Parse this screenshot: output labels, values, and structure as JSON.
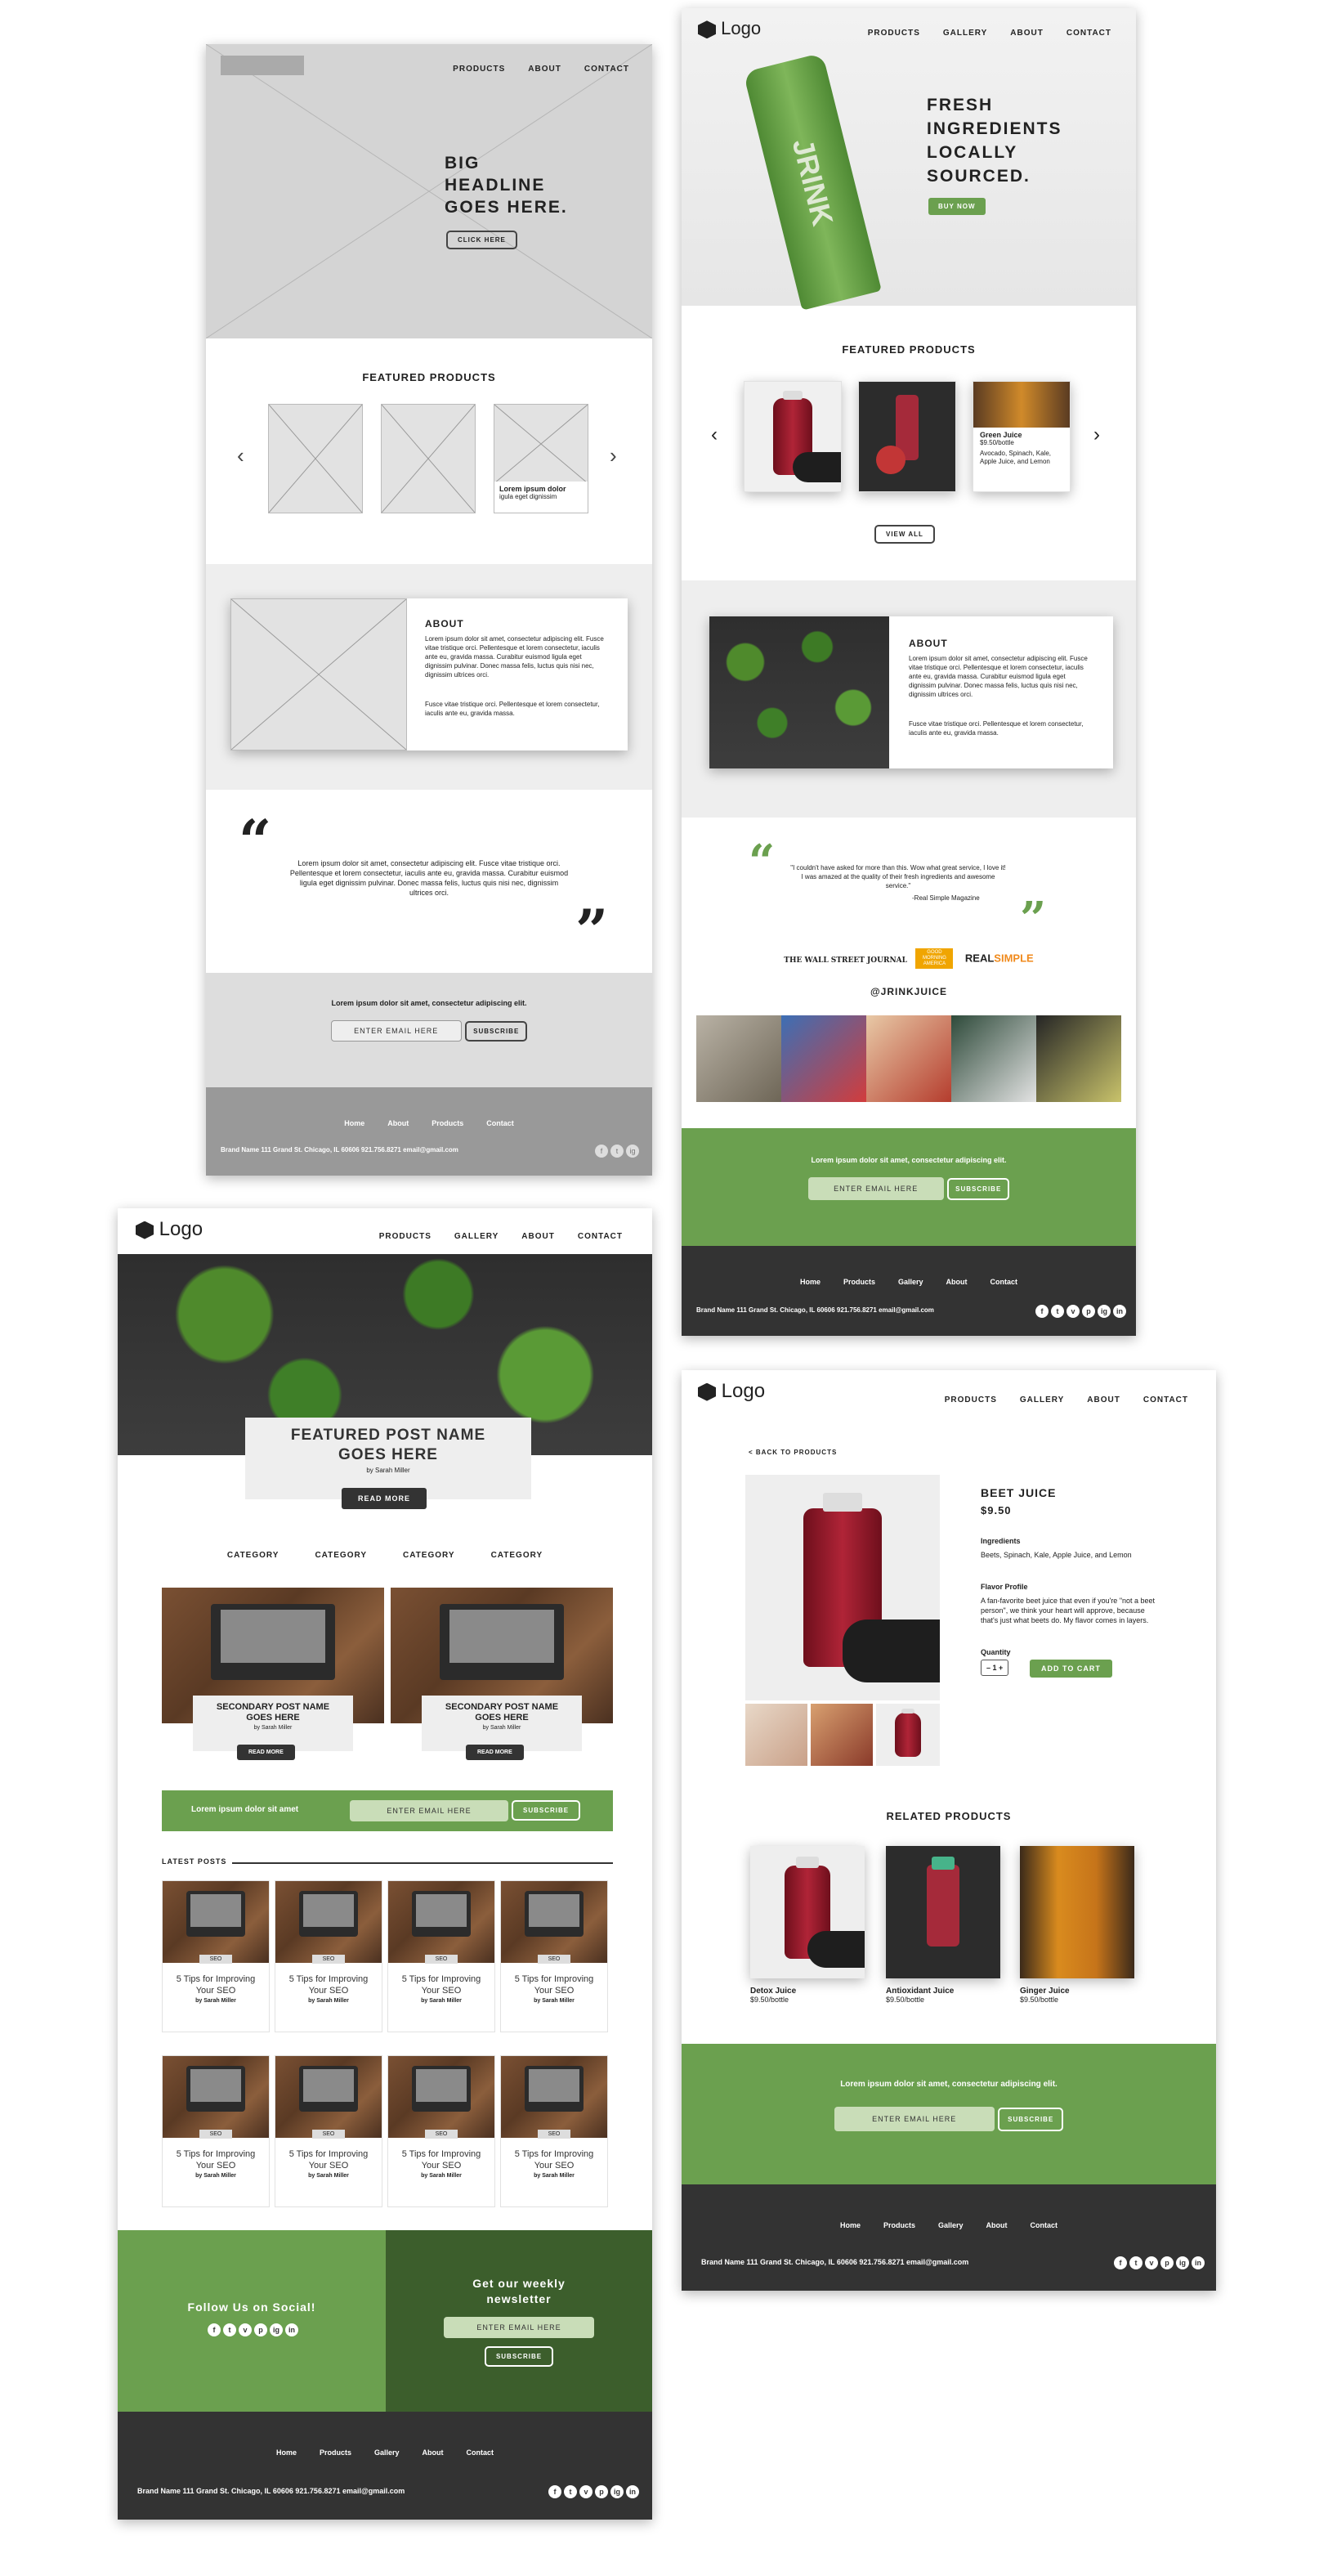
{
  "wireframe": {
    "nav": [
      "PRODUCTS",
      "ABOUT",
      "CONTACT"
    ],
    "headline": "BIG HEADLINE GOES HERE.",
    "cta": "CLICK HERE",
    "featured_title": "FEATURED PRODUCTS",
    "prev": "‹",
    "next": "›",
    "product_name": "Lorem ipsum dolor",
    "product_sub": "igula eget dignissim",
    "about_title": "ABOUT",
    "about_p1": "Lorem ipsum dolor sit amet, consectetur adipiscing elit. Fusce vitae tristique orci. Pellentesque et lorem consectetur, iaculis ante eu, gravida massa. Curabitur euismod ligula eget dignissim pulvinar. Donec massa felis, luctus quis nisi nec, dignissim ultrices orci.",
    "about_p2": "Fusce vitae tristique orci. Pellentesque et lorem consectetur, iaculis ante eu, gravida massa.",
    "quote": "Lorem ipsum dolor sit amet, consectetur adipiscing elit. Fusce vitae tristique orci. Pellentesque et lorem consectetur, iaculis ante eu, gravida massa. Curabitur euismod ligula eget dignissim pulvinar. Donec massa felis, luctus quis nisi nec, dignissim ultrices orci.",
    "newsletter_text": "Lorem ipsum dolor sit amet, consectetur adipiscing elit.",
    "email_placeholder": "ENTER EMAIL HERE",
    "subscribe": "SUBSCRIBE",
    "footer_links": [
      "Home",
      "About",
      "Products",
      "Contact"
    ],
    "footer_info": "Brand Name  111 Grand St. Chicago, IL 60606  921.756.8271  email@gmail.com"
  },
  "home": {
    "logo": "Logo",
    "nav": [
      "PRODUCTS",
      "GALLERY",
      "ABOUT",
      "CONTACT"
    ],
    "headline": "FRESH INGREDIENTS LOCALLY SOURCED.",
    "cta": "BUY NOW",
    "bottle_brand": "JRINK",
    "featured_title": "FEATURED PRODUCTS",
    "product_name": "Green Juice",
    "product_price": "$9.50/bottle",
    "product_desc": "Avocado, Spinach, Kale, Apple Juice, and Lemon",
    "view_all": "VIEW ALL",
    "about_title": "ABOUT",
    "about_p1": "Lorem ipsum dolor sit amet, consectetur adipiscing elit. Fusce vitae tristique orci. Pellentesque et lorem consectetur, iaculis ante eu, gravida massa. Curabitur euismod ligula eget dignissim pulvinar. Donec massa felis, luctus quis nisi nec, dignissim ultrices orci.",
    "about_p2": "Fusce vitae tristique orci. Pellentesque et lorem consectetur, iaculis ante eu, gravida massa.",
    "testimonial": "\"I couldn't have asked for more than this. Wow what great service, I love it! I was amazed at the quality of their fresh ingredients and awesome service.\"",
    "testimonial_source": "-Real Simple Magazine",
    "press": [
      "THE WALL STREET JOURNAL",
      "GOOD MORNING AMERICA",
      "REAL",
      "SIMPLE"
    ],
    "instagram": "@JRINKJUICE",
    "newsletter_text": "Lorem ipsum dolor sit amet, consectetur adipiscing elit.",
    "email_placeholder": "ENTER EMAIL HERE",
    "subscribe": "SUBSCRIBE",
    "footer_links": [
      "Home",
      "Products",
      "Gallery",
      "About",
      "Contact"
    ],
    "footer_info": "Brand Name  111 Grand St. Chicago, IL 60606  921.756.8271  email@gmail.com"
  },
  "blog": {
    "logo": "Logo",
    "nav": [
      "PRODUCTS",
      "GALLERY",
      "ABOUT",
      "CONTACT"
    ],
    "featured_title": "FEATURED POST NAME GOES HERE",
    "featured_author": "by Sarah Miller",
    "read_more": "READ MORE",
    "categories": [
      "CATEGORY",
      "CATEGORY",
      "CATEGORY",
      "CATEGORY"
    ],
    "secondary": [
      {
        "title": "SECONDARY POST NAME GOES HERE",
        "author": "by Sarah Miller",
        "btn": "READ MORE"
      },
      {
        "title": "SECONDARY POST NAME GOES HERE",
        "author": "by Sarah Miller",
        "btn": "READ MORE"
      }
    ],
    "newsletter_text": "Lorem ipsum dolor sit amet",
    "email_placeholder": "ENTER EMAIL HERE",
    "subscribe": "SUBSCRIBE",
    "latest_title": "LATEST POSTS",
    "posts": [
      {
        "tag": "SEO",
        "title": "5 Tips for Improving Your SEO",
        "author": "by Sarah Miller"
      },
      {
        "tag": "SEO",
        "title": "5 Tips for Improving Your SEO",
        "author": "by Sarah Miller"
      },
      {
        "tag": "SEO",
        "title": "5 Tips for Improving Your SEO",
        "author": "by Sarah Miller"
      },
      {
        "tag": "SEO",
        "title": "5 Tips for Improving Your SEO",
        "author": "by Sarah Miller"
      },
      {
        "tag": "SEO",
        "title": "5 Tips for Improving Your SEO",
        "author": "by Sarah Miller"
      },
      {
        "tag": "SEO",
        "title": "5 Tips for Improving Your SEO",
        "author": "by Sarah Miller"
      },
      {
        "tag": "SEO",
        "title": "5 Tips for Improving Your SEO",
        "author": "by Sarah Miller"
      },
      {
        "tag": "SEO",
        "title": "5 Tips for Improving Your SEO",
        "author": "by Sarah Miller"
      }
    ],
    "follow": "Follow Us on Social!",
    "weekly": "Get our weekly newsletter",
    "footer_links": [
      "Home",
      "Products",
      "Gallery",
      "About",
      "Contact"
    ],
    "footer_info": "Brand Name  111 Grand St. Chicago, IL 60606  921.756.8271  email@gmail.com"
  },
  "product": {
    "logo": "Logo",
    "nav": [
      "PRODUCTS",
      "GALLERY",
      "ABOUT",
      "CONTACT"
    ],
    "back": "< BACK TO PRODUCTS",
    "name": "BEET JUICE",
    "price": "$9.50",
    "ingredients_label": "Ingredients",
    "ingredients": "Beets, Spinach, Kale, Apple Juice, and Lemon",
    "flavor_label": "Flavor Profile",
    "flavor": "A fan-favorite beet juice that even if you're \"not a beet person\", we think your heart will approve, because that's just what beets do.  My flavor comes in layers.",
    "quantity_label": "Quantity",
    "quantity": "– 1 +",
    "add_to_cart": "ADD TO CART",
    "related_title": "RELATED PRODUCTS",
    "related": [
      {
        "name": "Detox Juice",
        "price": "$9.50/bottle"
      },
      {
        "name": "Antioxidant Juice",
        "price": "$9.50/bottle"
      },
      {
        "name": "Ginger Juice",
        "price": "$9.50/bottle"
      }
    ],
    "newsletter_text": "Lorem ipsum dolor sit amet, consectetur adipiscing elit.",
    "email_placeholder": "ENTER EMAIL HERE",
    "subscribe": "SUBSCRIBE",
    "footer_links": [
      "Home",
      "Products",
      "Gallery",
      "About",
      "Contact"
    ],
    "footer_info": "Brand Name  111 Grand St. Chicago, IL 60606  921.756.8271  email@gmail.com"
  },
  "social_icons": [
    "f",
    "t",
    "v",
    "p",
    "ig",
    "in"
  ]
}
